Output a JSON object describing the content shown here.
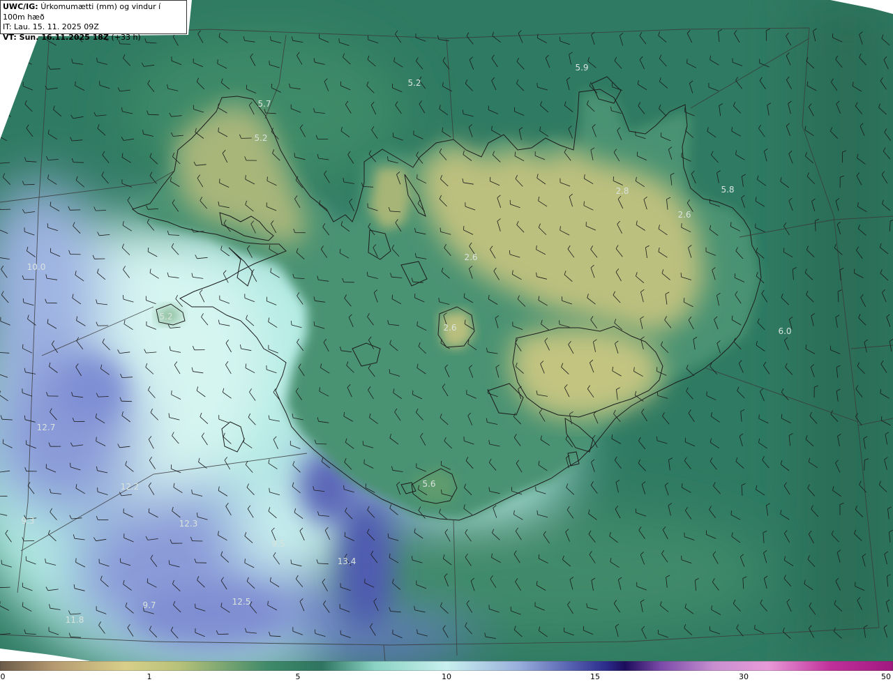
{
  "header": {
    "model_label": "UWC/IG:",
    "title": "Úrkomumætti (mm) og vindur í 100m hæð",
    "init_time": "IT: Lau. 15. 11. 2025 09Z",
    "valid_label": "VT: Sun. 16.11.2025 18Z",
    "lead_time": "(+33 h)"
  },
  "map_labels": [
    {
      "text": "5.9"
    },
    {
      "text": "5.2"
    },
    {
      "text": "5.7"
    },
    {
      "text": "5.2"
    },
    {
      "text": "2.8"
    },
    {
      "text": "5.8"
    },
    {
      "text": "2.6"
    },
    {
      "text": "2.6"
    },
    {
      "text": "10.0"
    },
    {
      "text": "5.2"
    },
    {
      "text": "2.6"
    },
    {
      "text": "6.0"
    },
    {
      "text": "12.7"
    },
    {
      "text": "12.2"
    },
    {
      "text": "5.6"
    },
    {
      "text": "12.3"
    },
    {
      "text": "9.3"
    },
    {
      "text": "9.5"
    },
    {
      "text": "13.4"
    },
    {
      "text": "12.5"
    },
    {
      "text": "11.8"
    },
    {
      "text": "9.7"
    }
  ],
  "colorbar": {
    "ticks": [
      {
        "label": "0",
        "value": 0
      },
      {
        "label": "1",
        "value": 1
      },
      {
        "label": "5",
        "value": 5
      },
      {
        "label": "10",
        "value": 10
      },
      {
        "label": "15",
        "value": 15
      },
      {
        "label": "30",
        "value": 30
      },
      {
        "label": "50",
        "value": 50
      }
    ],
    "colors": [
      "#6b5a48",
      "#b59a70",
      "#d8cf8a",
      "#b8c27a",
      "#3f8a6a",
      "#2e7460",
      "#8ad2c4",
      "#c8f0ee",
      "#9ab0dc",
      "#5560b0",
      "#2a2a8a",
      "#1c0c5a",
      "#7a4aa8",
      "#c890d0",
      "#e89ad8",
      "#c0309a",
      "#a01880"
    ],
    "color_stops": [
      0,
      0.06,
      0.14,
      0.2,
      0.3,
      0.36,
      0.42,
      0.5,
      0.58,
      0.64,
      0.68,
      0.7,
      0.74,
      0.8,
      0.86,
      0.93,
      1.0
    ]
  },
  "colors": {
    "sea_north": "#2f7a62",
    "sea_dark": "#2a6d57",
    "coast_green": "#4a9272",
    "land_yellow": "#bcc07e",
    "land_green": "#5e9a6c",
    "precip_cyan": "#b4ebe4",
    "precip_light": "#d6f5f1",
    "precip_blue": "#7b8fd4",
    "precip_dark": "#4f5bb0",
    "lines": "#222222"
  }
}
